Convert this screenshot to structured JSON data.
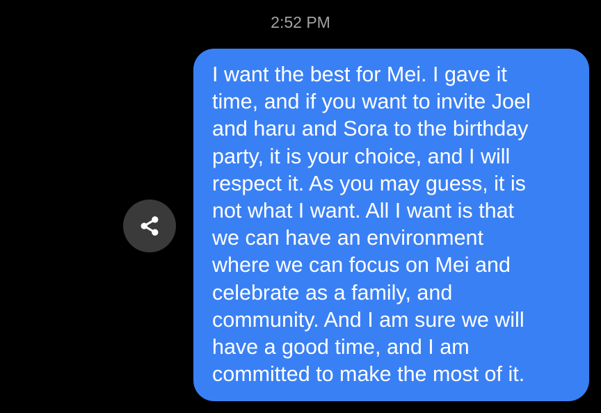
{
  "timestamp": "2:52 PM",
  "share_button": {
    "icon": "share-icon"
  },
  "message": {
    "lines": [
      "I want the best for Mei. I gave it",
      "time, and if you want to invite Joel",
      "and haru and Sora to the birthday",
      "party, it is your choice, and I will",
      "respect it. As you may guess, it is",
      "not what I want. All I want is that",
      "we can have an environment",
      "where we can focus on Mei and",
      "celebrate as a family, and",
      "community. And I am sure we will",
      "have a good time, and I am",
      "committed to make the most of it."
    ]
  },
  "colors": {
    "background": "#000000",
    "bubble": "#3a80f5",
    "timestamp": "#a3a3a3",
    "share_button_bg": "#3a3a3a"
  }
}
